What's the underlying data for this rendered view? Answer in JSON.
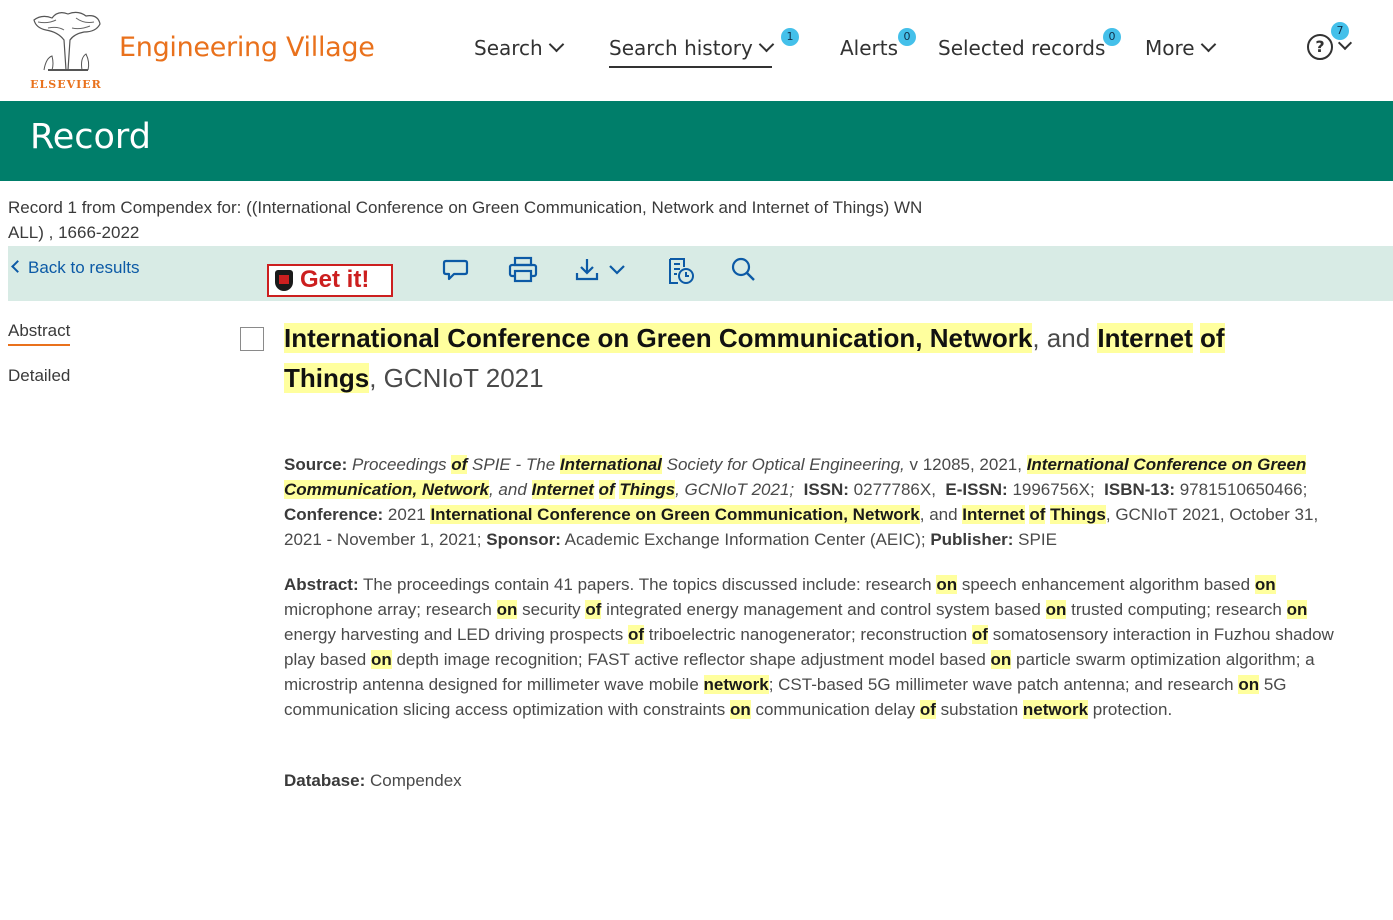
{
  "header": {
    "publisher": "ELSEVIER",
    "brand": "Engineering Village",
    "nav": {
      "search": "Search",
      "history": "Search history",
      "history_badge": "1",
      "alerts": "Alerts",
      "alerts_badge": "0",
      "selected": "Selected records",
      "selected_badge": "0",
      "more": "More",
      "help_badge": "7",
      "help_symbol": "?"
    }
  },
  "banner": {
    "title": "Record"
  },
  "query": "Record 1 from Compendex for: ((International Conference on Green Communication, Network and Internet of Things) WN ALL) , 1666-2022",
  "toolbar": {
    "back": "Back to results",
    "getit": "Get it!",
    "icons": [
      "comment-icon",
      "print-icon",
      "download-icon",
      "save-history-icon",
      "search-icon"
    ]
  },
  "side": {
    "abstract": "Abstract",
    "detailed": "Detailed"
  },
  "record": {
    "title": {
      "p1": "International Conference on Green Communication, Network",
      "p2": ", and ",
      "p3": "Internet",
      "p4": " ",
      "p5": "of",
      "p6": " ",
      "p7": "Things",
      "p8": ", GCNIoT 2021"
    },
    "source": {
      "label": "Source:",
      "t1": " Proceedings ",
      "h1": "of",
      "t2": " SPIE - The ",
      "h2": "International",
      "t3": " Society for Optical Engineering,",
      "t4": " v 12085, 2021, ",
      "h3": "International Conference on Green Communication, Network",
      "t5": ", and ",
      "h4": "Internet",
      "t6": " ",
      "h5": "of",
      "t7": " ",
      "h6": "Things",
      "t8": ", GCNIoT 2021;",
      "issn_label": "ISSN:",
      "issn": " 0277786X,",
      "eissn_label": "E-ISSN:",
      "eissn": " 1996756X;",
      "isbn_label": "ISBN-13:",
      "isbn": " 9781510650466;",
      "conf_label": "Conference:",
      "c1": " 2021 ",
      "ch1": "International Conference on Green Communication, Network",
      "c2": ", and ",
      "ch2": "Internet",
      "c3": " ",
      "ch3": "of",
      "c4": " ",
      "ch4": "Things",
      "c5": ", GCNIoT 2021, October 31, 2021 - November 1, 2021;",
      "sponsor_label": "Sponsor:",
      "sponsor": " Academic Exchange Information Center (AEIC);",
      "pub_label": "Publisher:",
      "pub": " SPIE"
    },
    "abstract": {
      "label": "Abstract:",
      "a1": " The proceedings contain 41 papers. The topics discussed include: research ",
      "h1": "on",
      "a2": " speech enhancement algorithm based ",
      "h2": "on",
      "a3": " microphone array; research ",
      "h3": "on",
      "a4": " security ",
      "h4": "of",
      "a5": " integrated energy management and control system based ",
      "h5": "on",
      "a6": " trusted computing; research ",
      "h6": "on",
      "a7": " energy harvesting and LED driving prospects ",
      "h7": "of",
      "a8": " triboelectric nanogenerator; reconstruction ",
      "h8": "of",
      "a9": " somatosensory interaction in Fuzhou shadow play based ",
      "h9": "on",
      "a10": " depth image recognition; FAST active reflector shape adjustment model based ",
      "h10": "on",
      "a11": " particle swarm optimization algorithm; a microstrip antenna designed for millimeter wave mobile ",
      "h11": "network",
      "a12": "; CST-based 5G millimeter wave patch antenna; and research ",
      "h12": "on",
      "a13": " 5G communication slicing access optimization with constraints ",
      "h13": "on",
      "a14": " communication delay ",
      "h14": "of",
      "a15": " substation ",
      "h15": "network",
      "a16": " protection."
    },
    "database": {
      "label": "Database:",
      "value": " Compendex"
    }
  }
}
